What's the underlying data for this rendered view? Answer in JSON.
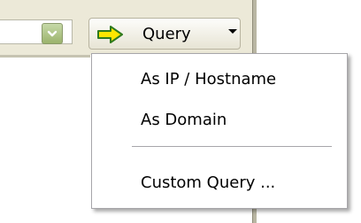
{
  "toolbar": {
    "query_button": {
      "label": "Query",
      "icon": "right-arrow-icon",
      "caret_icon": "caret-down-icon"
    },
    "combo_icon": "chevron-down-icon"
  },
  "query_menu": {
    "items": [
      {
        "label": "As IP / Hostname"
      },
      {
        "label": "As Domain"
      },
      {
        "label": "Custom Query ..."
      }
    ]
  },
  "colors": {
    "toolbar_bg": "#ece9d8",
    "arrow_fill": "#ffe600",
    "arrow_stroke": "#2f7a1e",
    "combo_button": "#9bb36c",
    "menu_border": "#a7a6aa"
  }
}
